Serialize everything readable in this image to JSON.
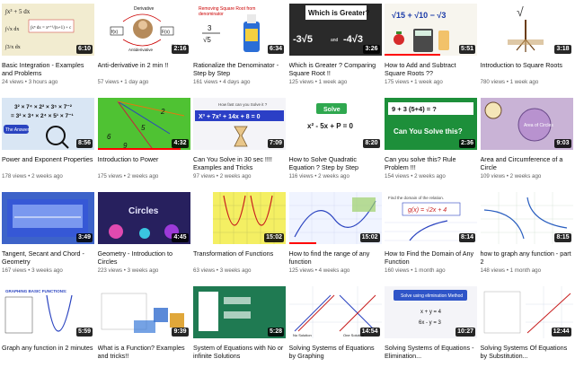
{
  "videos": [
    {
      "title": "Basic Integration - Examples and Problems",
      "views": "24 views",
      "age": "3 hours ago",
      "duration": "6:10",
      "thumb_text": [
        "∫x³ + 5 dx",
        "∫xⁿ dx = xⁿ⁺¹/(n+1) + c",
        "∫√x dx",
        "∫3/x dx"
      ],
      "bg": "#f2ecd0",
      "progress": 0
    },
    {
      "title": "Anti-derivative in 2 min !!",
      "views": "57 views",
      "age": "1 day ago",
      "duration": "2:16",
      "thumb_text": [
        "Derivative",
        "f(x)",
        "F(x)",
        "Antiderivative",
        "F'(x) = f(x)"
      ],
      "bg": "#ffffff",
      "progress": 0
    },
    {
      "title": "Rationalize the Denominator - Step by Step",
      "views": "161 views",
      "age": "4 days ago",
      "duration": "6:34",
      "thumb_text": [
        "Removing Square Root from denominator",
        "3",
        "√5"
      ],
      "bg": "#ffffff",
      "progress": 0
    },
    {
      "title": "Which is Greater ? Comparing Square Root !!",
      "views": "125 views",
      "age": "1 week ago",
      "duration": "3:26",
      "thumb_text": [
        "Which is Greater?",
        "-3√5",
        "and",
        "-4√3"
      ],
      "bg": "#1a1a1a",
      "progress": 0
    },
    {
      "title": "How to Add and Subtract Square Roots ??",
      "views": "175 views",
      "age": "1 week ago",
      "duration": "5:51",
      "thumb_text": [
        "√15 + √10 − √3"
      ],
      "bg": "#f7f5ee",
      "progress": 0.6
    },
    {
      "title": "Introduction to Square Roots",
      "views": "780 views",
      "age": "1 week ago",
      "duration": "3:18",
      "thumb_text": [
        "√"
      ],
      "bg": "#ffffff",
      "progress": 0
    },
    {
      "title": "Power and Exponent Properties",
      "views": "178 views",
      "age": "2 weeks ago",
      "duration": "8:56",
      "thumb_text": [
        "3² × 7⁴ × 2² × 3⁵ × 7⁻²",
        "= 3² × 3⁴ × 2⁴ × 5¹ × 7⁻¹",
        "The Answer:"
      ],
      "bg": "#d9e6f4",
      "progress": 0
    },
    {
      "title": "Introduction to Power",
      "views": "175 views",
      "age": "2 weeks ago",
      "duration": "4:32",
      "thumb_text": [
        "2",
        "5",
        "6",
        "9"
      ],
      "bg": "#4fc233",
      "progress": 0.9
    },
    {
      "title": "Can You Solve in 30 sec !!!! Examples and Tricks",
      "views": "97 views",
      "age": "2 weeks ago",
      "duration": "7:09",
      "thumb_text": [
        "How fast can you Solve it ?",
        "X³ + 7x² + 14x + 8 = 0"
      ],
      "bg": "#f4f4f8",
      "progress": 0
    },
    {
      "title": "How to Solve Quadratic Equation ? Step by Step",
      "views": "116 views",
      "age": "2 weeks ago",
      "duration": "8:20",
      "thumb_text": [
        "Solve",
        "x² - 5x + P = 0"
      ],
      "bg": "#ffffff",
      "progress": 0
    },
    {
      "title": "Can you solve this? Rule Problem !!!",
      "views": "154 views",
      "age": "2 weeks ago",
      "duration": "2:36",
      "thumb_text": [
        "9 + 3 (5+4) = ?",
        "Can You Solve this?"
      ],
      "bg": "#1d8f3a",
      "progress": 0
    },
    {
      "title": "Area and Circumference of a Circle",
      "views": "109 views",
      "age": "2 weeks ago",
      "duration": "9:03",
      "thumb_text": [
        "Area of Circles"
      ],
      "bg": "#c9b3d6",
      "progress": 0
    },
    {
      "title": "Tangent, Secant and Chord - Geometry",
      "views": "167 views",
      "age": "3 weeks ago",
      "duration": "3:49",
      "thumb_text": [],
      "bg": "#3d63c9",
      "progress": 0
    },
    {
      "title": "Geometry - Introduction to Circles",
      "views": "223 views",
      "age": "3 weeks ago",
      "duration": "4:45",
      "thumb_text": [
        "Circles"
      ],
      "bg": "#2d2266",
      "progress": 0
    },
    {
      "title": "Transformation of Functions",
      "views": "63 views",
      "age": "3 weeks ago",
      "duration": "15:02",
      "thumb_text": [],
      "bg": "#f4ef63",
      "progress": 0
    },
    {
      "title": "How to find the range of any function",
      "views": "125 views",
      "age": "4 weeks ago",
      "duration": "15:02",
      "thumb_text": [],
      "bg": "#f0f4ff",
      "progress": 0.3
    },
    {
      "title": "How to Find the Domain of Any Function",
      "views": "160 views",
      "age": "1 month ago",
      "duration": "8:14",
      "thumb_text": [
        "Find the domain of the relation.",
        "g(x) = √2x + 4"
      ],
      "bg": "#ffffff",
      "progress": 0
    },
    {
      "title": "how to graph any function - part 2",
      "views": "148 views",
      "age": "1 month ago",
      "duration": "8:15",
      "thumb_text": [],
      "bg": "#ffffff",
      "progress": 0
    },
    {
      "title": "Graph any function in 2 minutes",
      "views": "",
      "age": "",
      "duration": "5:59",
      "thumb_text": [
        "GRAPHING BASIC FUNCTIONS:"
      ],
      "bg": "#ffffff",
      "progress": 0
    },
    {
      "title": "What is a Function? Examples and tricks!!",
      "views": "",
      "age": "",
      "duration": "9:39",
      "thumb_text": [],
      "bg": "#ffffff",
      "progress": 0
    },
    {
      "title": "System of Equations with No or infinite Solutions",
      "views": "",
      "age": "",
      "duration": "5:28",
      "thumb_text": [],
      "bg": "#1f7a52",
      "progress": 0
    },
    {
      "title": "Solving Systems of Equations by Graphing",
      "views": "",
      "age": "",
      "duration": "14:54",
      "thumb_text": [
        "No Solution",
        "One Solution"
      ],
      "bg": "#ffffff",
      "progress": 0
    },
    {
      "title": "Solving Systems of Equations - Elimination...",
      "views": "",
      "age": "",
      "duration": "10:27",
      "thumb_text": [
        "Solve using elimination Method",
        "x + y = 4",
        "6x - y = 3"
      ],
      "bg": "#f4f4f8",
      "progress": 0
    },
    {
      "title": "Solving Systems Of Equations by Substitution...",
      "views": "",
      "age": "",
      "duration": "12:44",
      "thumb_text": [],
      "bg": "#ffffff",
      "progress": 0
    }
  ],
  "meta_separator": " • "
}
